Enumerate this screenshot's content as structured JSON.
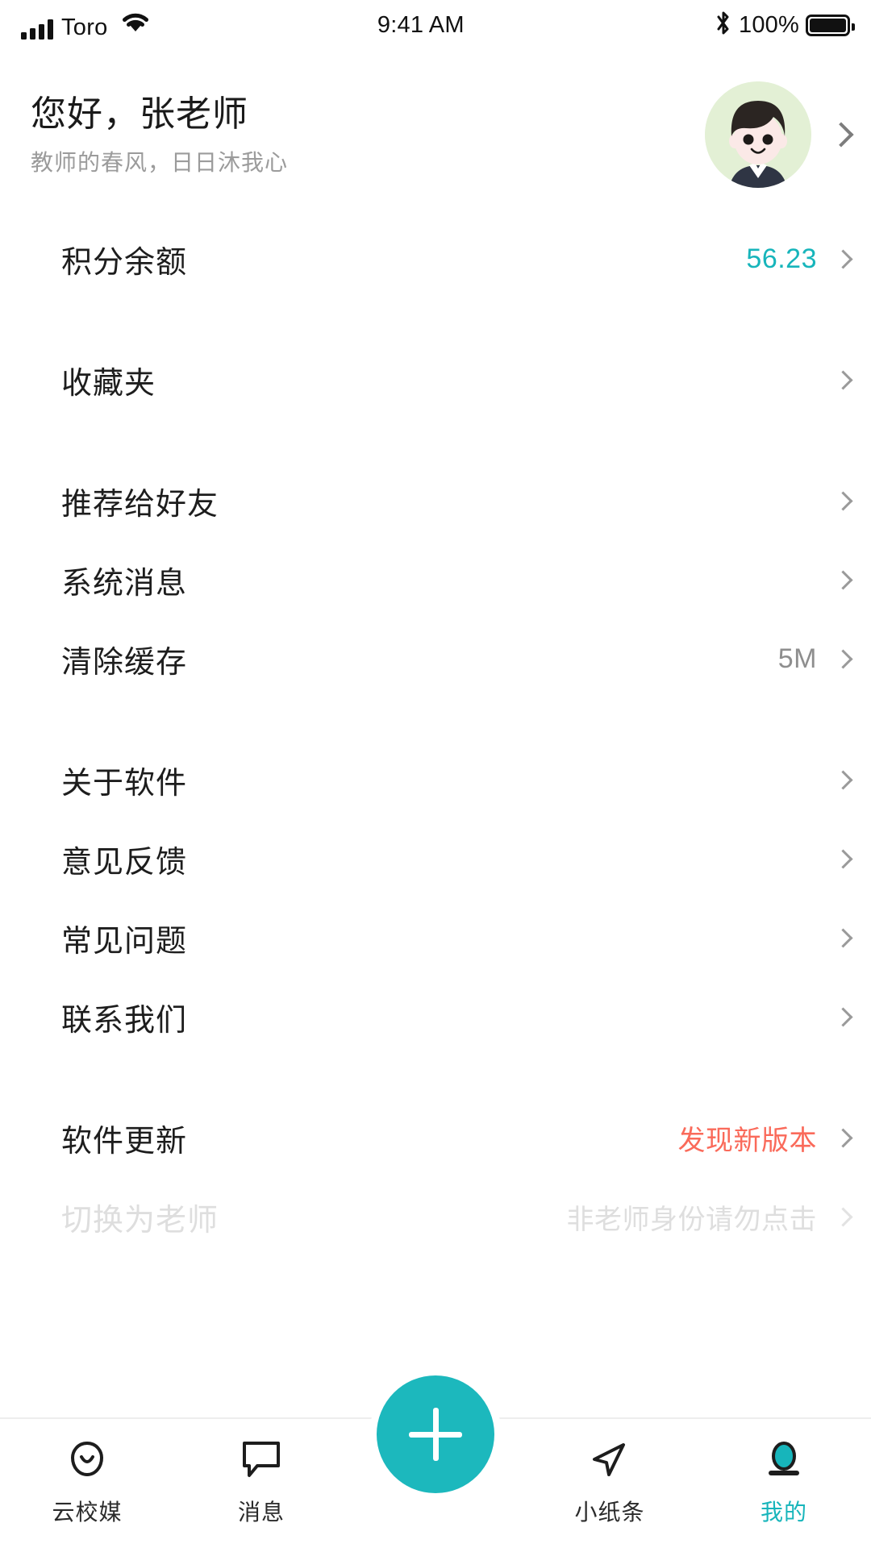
{
  "status_bar": {
    "carrier": "Toro",
    "time": "9:41 AM",
    "battery_percent": "100%",
    "signal_icon": "signal-bars-icon",
    "wifi_icon": "wifi-icon",
    "bluetooth_icon": "bluetooth-icon",
    "battery_icon": "battery-full-icon"
  },
  "header": {
    "greeting": "您好，张老师",
    "subtitle": "教师的春风，日日沐我心",
    "avatar_alt": "teacher-avatar",
    "chevron_icon": "chevron-right-icon"
  },
  "colors": {
    "accent_teal": "#17b5bb",
    "fab_teal": "#1cb8bd",
    "alert_red": "#fa6a5a",
    "value_gray": "#8e8e8e",
    "avatar_bg": "#e3f0d5"
  },
  "groups": [
    {
      "items": [
        {
          "label": "积分余额",
          "value": "56.23",
          "value_style": "teal",
          "chevron": true
        }
      ]
    },
    {
      "items": [
        {
          "label": "收藏夹",
          "value": "",
          "value_style": "none",
          "chevron": true
        }
      ]
    },
    {
      "items": [
        {
          "label": "推荐给好友",
          "value": "",
          "value_style": "none",
          "chevron": true
        },
        {
          "label": "系统消息",
          "value": "",
          "value_style": "none",
          "chevron": true
        },
        {
          "label": "清除缓存",
          "value": "5M",
          "value_style": "gray",
          "chevron": true
        }
      ]
    },
    {
      "items": [
        {
          "label": "关于软件",
          "value": "",
          "value_style": "none",
          "chevron": true
        },
        {
          "label": "意见反馈",
          "value": "",
          "value_style": "none",
          "chevron": true
        },
        {
          "label": "常见问题",
          "value": "",
          "value_style": "none",
          "chevron": true
        },
        {
          "label": "联系我们",
          "value": "",
          "value_style": "none",
          "chevron": true
        }
      ]
    },
    {
      "items": [
        {
          "label": "软件更新",
          "value": "发现新版本",
          "value_style": "red",
          "chevron": true
        },
        {
          "label": "切换为老师",
          "value": "非老师身份请勿点击",
          "value_style": "faded",
          "chevron": true
        }
      ]
    }
  ],
  "tabbar": {
    "items": [
      {
        "label": "云校媒",
        "icon": "cloud-icon",
        "active": false
      },
      {
        "label": "消息",
        "icon": "message-bubble-icon",
        "active": false
      },
      {
        "label": "小纸条",
        "icon": "paper-plane-icon",
        "active": false
      },
      {
        "label": "我的",
        "icon": "person-icon",
        "active": true
      }
    ],
    "fab_icon": "plus-icon",
    "fab_label": "+"
  }
}
